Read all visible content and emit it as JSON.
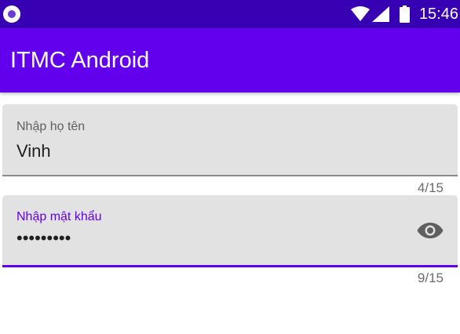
{
  "status_bar": {
    "time": "15:46",
    "icons": [
      "app-notification-icon",
      "wifi-icon",
      "signal-icon",
      "battery-icon"
    ]
  },
  "app_bar": {
    "title": "ITMC Android",
    "color": "#6200ee"
  },
  "form": {
    "name_field": {
      "label": "Nhập họ tên",
      "value": "Vinh",
      "counter": "4/15"
    },
    "password_field": {
      "label": "Nhập mật khẩu",
      "value": "•••••••••",
      "counter": "9/15",
      "toggle_icon": "eye-icon"
    }
  },
  "colors": {
    "status_bar": "#3700b3",
    "primary": "#6200ee",
    "field_background": "#e2e2e2"
  }
}
